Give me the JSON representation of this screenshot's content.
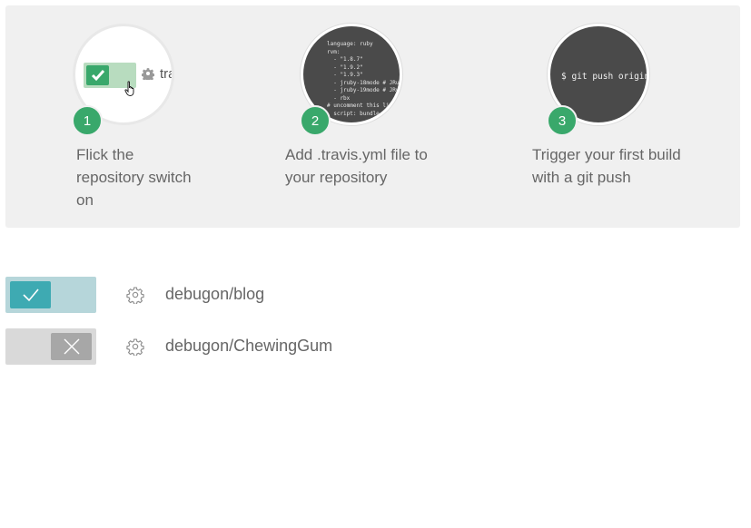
{
  "onboarding": {
    "steps": [
      {
        "number": "1",
        "text": "Flick the repository switch on",
        "illustration": {
          "repo_text": "tra"
        }
      },
      {
        "number": "2",
        "text": "Add .travis.yml file to your repository",
        "illustration": {
          "code": "language: ruby\nrvm:\n  - \"1.8.7\"\n  - \"1.9.2\"\n  - \"1.9.3\"\n  - jruby-18mode # JRuby\n  - jruby-19mode # JRuby\n  - rbx\n# uncomment this line\n  script: bundle"
        }
      },
      {
        "number": "3",
        "text": "Trigger your first build with a git push",
        "illustration": {
          "command": "$ git push origin"
        }
      }
    ]
  },
  "repos": [
    {
      "name": "debugon/blog",
      "enabled": true,
      "toggle_icon": "checkmark-icon"
    },
    {
      "name": "debugon/ChewingGum",
      "enabled": false,
      "toggle_icon": "x-icon"
    }
  ],
  "colors": {
    "panel_bg": "#f0f0f0",
    "badge_green": "#39a86b",
    "toggle_on_bg": "#b6d6da",
    "toggle_on_knob": "#3eaab2",
    "toggle_off_bg": "#d9d9d9",
    "toggle_off_knob": "#a7a7a7"
  }
}
